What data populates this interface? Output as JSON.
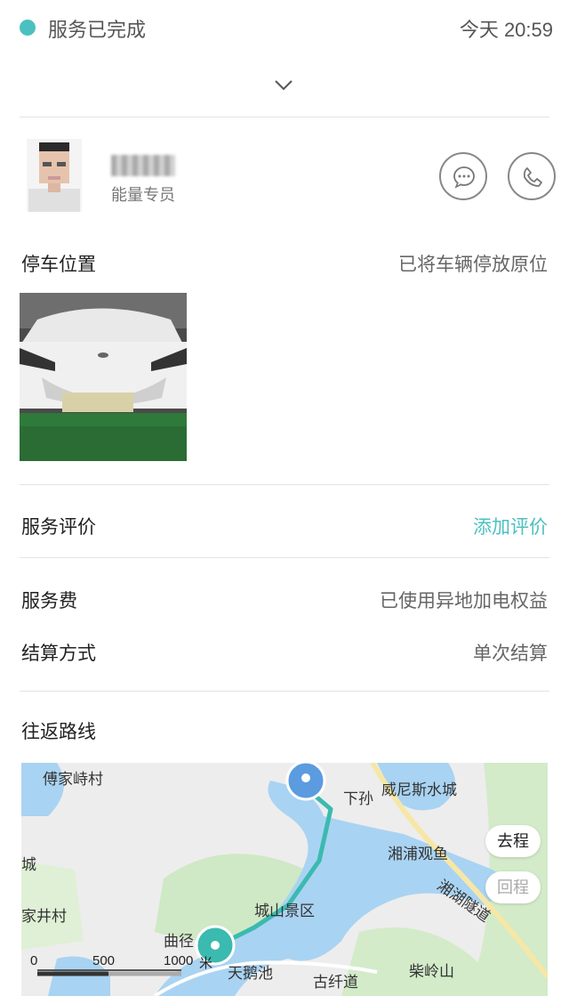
{
  "status": {
    "text": "服务已完成",
    "time": "今天 20:59",
    "dot_color": "#4cc0c0"
  },
  "collapse": {
    "icon": "chevron-down-icon"
  },
  "agent": {
    "name_obscured": true,
    "role": "能量专员",
    "actions": [
      {
        "icon": "chat-bubble-icon"
      },
      {
        "icon": "phone-icon"
      }
    ]
  },
  "parking": {
    "label": "停车位置",
    "value": "已将车辆停放原位"
  },
  "rating": {
    "label": "服务评价",
    "action": "添加评价",
    "accent": "#4cc0c0"
  },
  "fee": {
    "label": "服务费",
    "value": "已使用异地加电权益"
  },
  "settlement": {
    "label": "结算方式",
    "value": "单次结算"
  },
  "route": {
    "label": "往返路线",
    "map": {
      "places": [
        "傅家峙村",
        "下孙",
        "威尼斯水城",
        "湘浦观鱼",
        "湘湖隧道",
        "城山景区",
        "曲径",
        "家井村",
        "天鹅池",
        "古纤道",
        "柴岭山",
        "城"
      ],
      "buttons": {
        "outbound": "去程",
        "return": "回程"
      },
      "scale": [
        "0",
        "500",
        "1000",
        "米"
      ]
    }
  }
}
